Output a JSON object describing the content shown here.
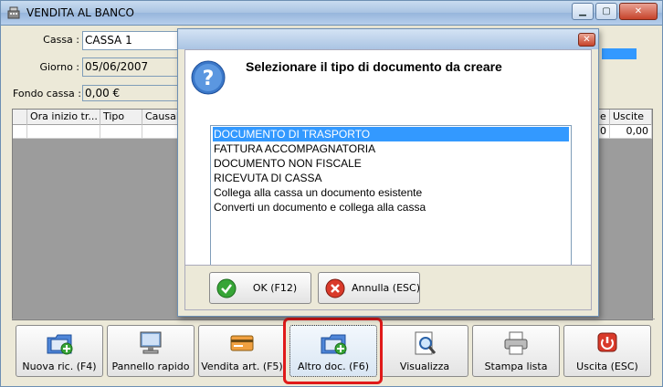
{
  "window": {
    "title": "VENDITA AL BANCO"
  },
  "form": {
    "cassa_label": "Cassa :",
    "cassa_value": "CASSA 1",
    "giorno_label": "Giorno :",
    "giorno_value": "05/06/2007",
    "fondo_label": "Fondo cassa :",
    "fondo_value": "0,00 €"
  },
  "grid": {
    "columns": [
      "Ora inizio tr...",
      "Tipo",
      "Causale",
      "e",
      "Uscite"
    ],
    "row": {
      "entrate": "0",
      "uscite": "0,00"
    }
  },
  "dialog": {
    "heading": "Selezionare il tipo di documento da creare",
    "options": [
      "DOCUMENTO DI TRASPORTO",
      "FATTURA ACCOMPAGNATORIA",
      "DOCUMENTO NON FISCALE",
      "RICEVUTA DI CASSA",
      "Collega alla cassa un documento esistente",
      "Converti un documento e collega alla cassa"
    ],
    "selected_index": 0,
    "ok_label": "OK (F12)",
    "cancel_label": "Annulla (ESC)"
  },
  "toolbar": {
    "buttons": [
      {
        "label": "Nuova ric. (F4)",
        "icon": "folder-add-icon"
      },
      {
        "label": "Pannello rapido",
        "icon": "monitor-icon"
      },
      {
        "label": "Vendita art. (F5)",
        "icon": "card-icon"
      },
      {
        "label": "Altro doc. (F6)",
        "icon": "folder-add-icon"
      },
      {
        "label": "Visualizza",
        "icon": "magnifier-icon"
      },
      {
        "label": "Stampa lista",
        "icon": "printer-icon"
      },
      {
        "label": "Uscita (ESC)",
        "icon": "power-icon"
      }
    ]
  },
  "colors": {
    "selection": "#3399ff",
    "highlight": "#e01a1a"
  }
}
